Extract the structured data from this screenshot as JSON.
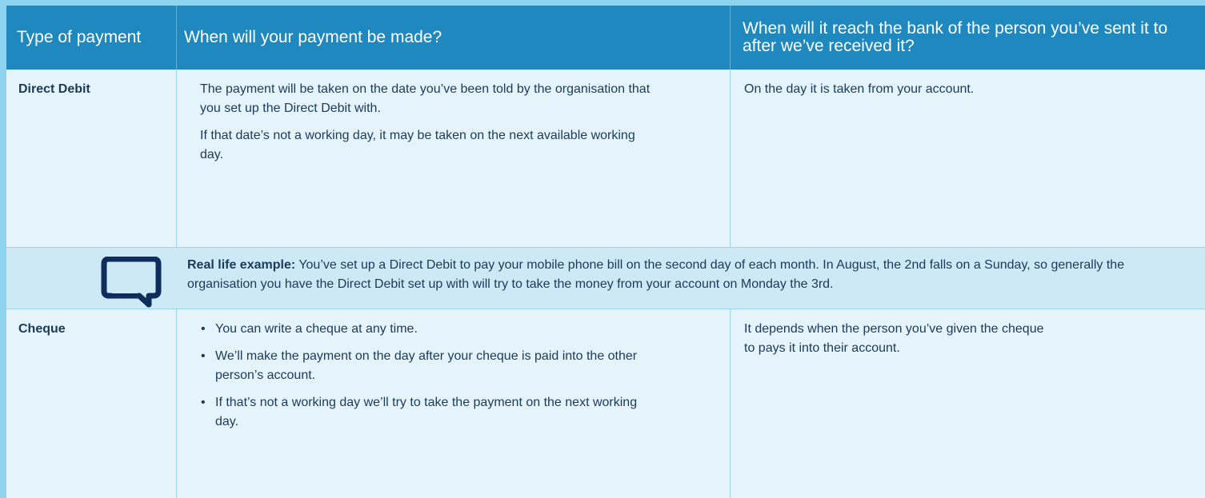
{
  "header": {
    "col1": "Type of payment",
    "col2": "When will your payment be made?",
    "col3": "When will it reach the bank of the person you’ve sent it to after we’ve received it?"
  },
  "rows": [
    {
      "type": "Direct Debit",
      "when_made": [
        "The payment will be taken on the date you’ve been told by the organisation that you set up the Direct Debit with.",
        "If that date’s not a working day, it may be taken on the next available working day."
      ],
      "when_reach": "On the day it is taken from your account."
    },
    {
      "type": "Cheque",
      "when_made_bullets": [
        "You can write a cheque at any time.",
        "We’ll make the payment on the day after your cheque is paid into the other person’s account.",
        "If that’s not a working day we’ll try to take the payment on the next working day."
      ],
      "when_reach": "It depends when the person you’ve given the cheque to pays it into their account."
    }
  ],
  "example": {
    "label": "Real life example:",
    "text": "You’ve set up a Direct Debit to pay your mobile phone bill on the second day of each month. In August, the 2nd falls on a Sunday, so generally the organisation you have the Direct Debit set up with will try to take the money from your account on Monday the 3rd.",
    "icon": "speech-bubble-icon"
  },
  "colors": {
    "header_bg": "#1f88be",
    "row_bg": "#e5f4fa",
    "example_bg": "#cce9f5",
    "icon": "#0f2d5c",
    "accent": "#8fd4ee"
  }
}
